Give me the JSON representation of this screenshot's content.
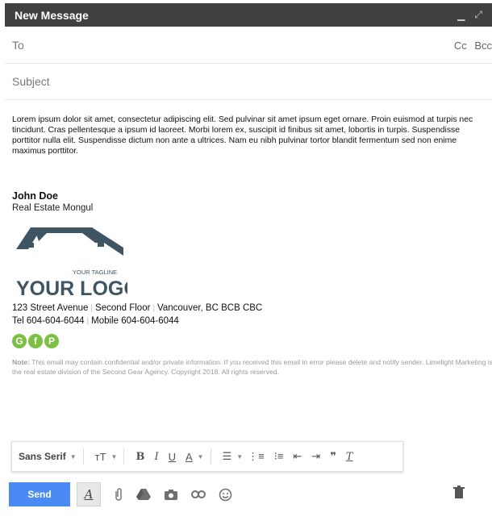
{
  "window": {
    "title": "New Message",
    "minimize_icon": "minimize-icon",
    "expand_icon": "expand-icon"
  },
  "fields": {
    "to_label": "To",
    "cc_label": "Cc",
    "bcc_label": "Bcc",
    "subject_placeholder": "Subject"
  },
  "message": {
    "body": "Lorem ipsum dolor sit amet, consectetur adipiscing elit. Sed pulvinar sit amet ipsum eget ornare. Proin euismod at turpis nec tincidunt. Cras pellentesque a ipsum id laoreet. Morbi lorem ex, suscipit id finibus sit amet, lobortis in turpis. Suspendisse porttitor nulla elit. Suspendisse dictum non ante a ultrices. Nam eu nibh pulvinar tortor blandit fermentum sed non enime maximus porttitor."
  },
  "signature": {
    "name": "John Doe",
    "title": "Real Estate Mongul",
    "logo": {
      "tagline": "YOUR TAGLINE",
      "text": "YOUR LOGO",
      "color": "#3f5563"
    },
    "address_line1": "123 Street Avenue",
    "address_line2": "Second Floor",
    "address_line3": "Vancouver, BC BCB CBC",
    "tel": "Tel 604-604-6044",
    "mobile": "Mobile 604-604-6044",
    "social": [
      "G",
      "f",
      "P"
    ],
    "social_color": "#7bc043",
    "note_label": "Note:",
    "note_text": "This email may contain confidential and/or private information. If you received this email in error please delete and notify sender. Limelight Marketing is the real estate division of the Second Gear Agency. Copyright 2018. All rights reserved."
  },
  "toolbar": {
    "font": "Sans Serif",
    "bold": "B",
    "italic": "I",
    "underline": "U",
    "text_color": "A"
  },
  "bottom": {
    "send_label": "Send",
    "send_color": "#4a8af4",
    "formatting_label": "A"
  }
}
